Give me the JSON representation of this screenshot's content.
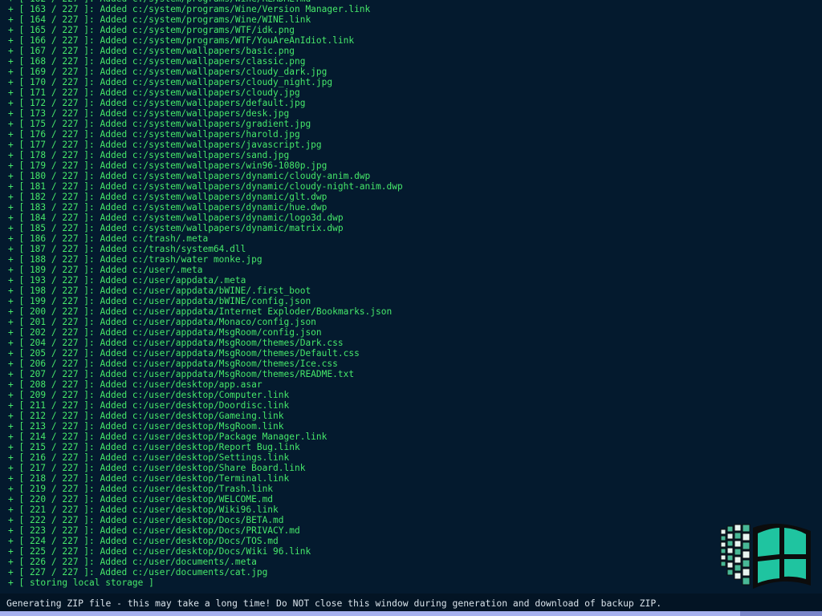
{
  "log": {
    "total": 227,
    "prefix": "+",
    "verb": "Added",
    "entries": [
      {
        "n": 163,
        "path": "c:/system/programs/Wine/Version Manager.link"
      },
      {
        "n": 164,
        "path": "c:/system/programs/Wine/WINE.link"
      },
      {
        "n": 165,
        "path": "c:/system/programs/WTF/idk.png"
      },
      {
        "n": 166,
        "path": "c:/system/programs/WTF/YouAreAnIdiot.link"
      },
      {
        "n": 167,
        "path": "c:/system/wallpapers/basic.png"
      },
      {
        "n": 168,
        "path": "c:/system/wallpapers/classic.png"
      },
      {
        "n": 169,
        "path": "c:/system/wallpapers/cloudy_dark.jpg"
      },
      {
        "n": 170,
        "path": "c:/system/wallpapers/cloudy_night.jpg"
      },
      {
        "n": 171,
        "path": "c:/system/wallpapers/cloudy.jpg"
      },
      {
        "n": 172,
        "path": "c:/system/wallpapers/default.jpg"
      },
      {
        "n": 173,
        "path": "c:/system/wallpapers/desk.jpg"
      },
      {
        "n": 175,
        "path": "c:/system/wallpapers/gradient.jpg"
      },
      {
        "n": 176,
        "path": "c:/system/wallpapers/harold.jpg"
      },
      {
        "n": 177,
        "path": "c:/system/wallpapers/javascript.jpg"
      },
      {
        "n": 178,
        "path": "c:/system/wallpapers/sand.jpg"
      },
      {
        "n": 179,
        "path": "c:/system/wallpapers/win96-1080p.jpg"
      },
      {
        "n": 180,
        "path": "c:/system/wallpapers/dynamic/cloudy-anim.dwp"
      },
      {
        "n": 181,
        "path": "c:/system/wallpapers/dynamic/cloudy-night-anim.dwp"
      },
      {
        "n": 182,
        "path": "c:/system/wallpapers/dynamic/glt.dwp"
      },
      {
        "n": 183,
        "path": "c:/system/wallpapers/dynamic/hue.dwp"
      },
      {
        "n": 184,
        "path": "c:/system/wallpapers/dynamic/logo3d.dwp"
      },
      {
        "n": 185,
        "path": "c:/system/wallpapers/dynamic/matrix.dwp"
      },
      {
        "n": 186,
        "path": "c:/trash/.meta"
      },
      {
        "n": 187,
        "path": "c:/trash/system64.dll"
      },
      {
        "n": 188,
        "path": "c:/trash/water monke.jpg"
      },
      {
        "n": 189,
        "path": "c:/user/.meta"
      },
      {
        "n": 193,
        "path": "c:/user/appdata/.meta"
      },
      {
        "n": 198,
        "path": "c:/user/appdata/bWINE/.first_boot"
      },
      {
        "n": 199,
        "path": "c:/user/appdata/bWINE/config.json"
      },
      {
        "n": 200,
        "path": "c:/user/appdata/Internet Exploder/Bookmarks.json"
      },
      {
        "n": 201,
        "path": "c:/user/appdata/Monaco/config.json"
      },
      {
        "n": 202,
        "path": "c:/user/appdata/MsgRoom/config.json"
      },
      {
        "n": 204,
        "path": "c:/user/appdata/MsgRoom/themes/Dark.css"
      },
      {
        "n": 205,
        "path": "c:/user/appdata/MsgRoom/themes/Default.css"
      },
      {
        "n": 206,
        "path": "c:/user/appdata/MsgRoom/themes/Ice.css"
      },
      {
        "n": 207,
        "path": "c:/user/appdata/MsgRoom/themes/README.txt"
      },
      {
        "n": 208,
        "path": "c:/user/desktop/app.asar"
      },
      {
        "n": 209,
        "path": "c:/user/desktop/Computer.link"
      },
      {
        "n": 211,
        "path": "c:/user/desktop/Doordisc.link"
      },
      {
        "n": 212,
        "path": "c:/user/desktop/Gameing.link"
      },
      {
        "n": 213,
        "path": "c:/user/desktop/MsgRoom.link"
      },
      {
        "n": 214,
        "path": "c:/user/desktop/Package Manager.link"
      },
      {
        "n": 215,
        "path": "c:/user/desktop/Report Bug.link"
      },
      {
        "n": 216,
        "path": "c:/user/desktop/Settings.link"
      },
      {
        "n": 217,
        "path": "c:/user/desktop/Share Board.link"
      },
      {
        "n": 218,
        "path": "c:/user/desktop/Terminal.link"
      },
      {
        "n": 219,
        "path": "c:/user/desktop/Trash.link"
      },
      {
        "n": 220,
        "path": "c:/user/desktop/WELCOME.md"
      },
      {
        "n": 221,
        "path": "c:/user/desktop/Wiki96.link"
      },
      {
        "n": 222,
        "path": "c:/user/desktop/Docs/BETA.md"
      },
      {
        "n": 223,
        "path": "c:/user/desktop/Docs/PRIVACY.md"
      },
      {
        "n": 224,
        "path": "c:/user/desktop/Docs/TOS.md"
      },
      {
        "n": 225,
        "path": "c:/user/desktop/Docs/Wiki 96.link"
      },
      {
        "n": 226,
        "path": "c:/user/documents/.meta"
      },
      {
        "n": 227,
        "path": "c:/user/documents/cat.jpg"
      }
    ],
    "final_line": "+ [ storing local storage ]"
  },
  "status": {
    "message": "Generating ZIP file - this may take a long time! Do NOT close this window during generation and download of backup ZIP.",
    "progress_fraction": 0.9
  },
  "logo": {
    "icon": "windows96-logo-icon",
    "colors": {
      "pane": "#1fc4a0",
      "frame": "#0c0c0c",
      "tail_light": "#e8f4f0",
      "tail_dark": "#48b896"
    }
  },
  "colors": {
    "background": "#041a2e",
    "log_text": "#46e86a",
    "status_text": "#d8e2ea",
    "progress": "#a7b1ee"
  }
}
